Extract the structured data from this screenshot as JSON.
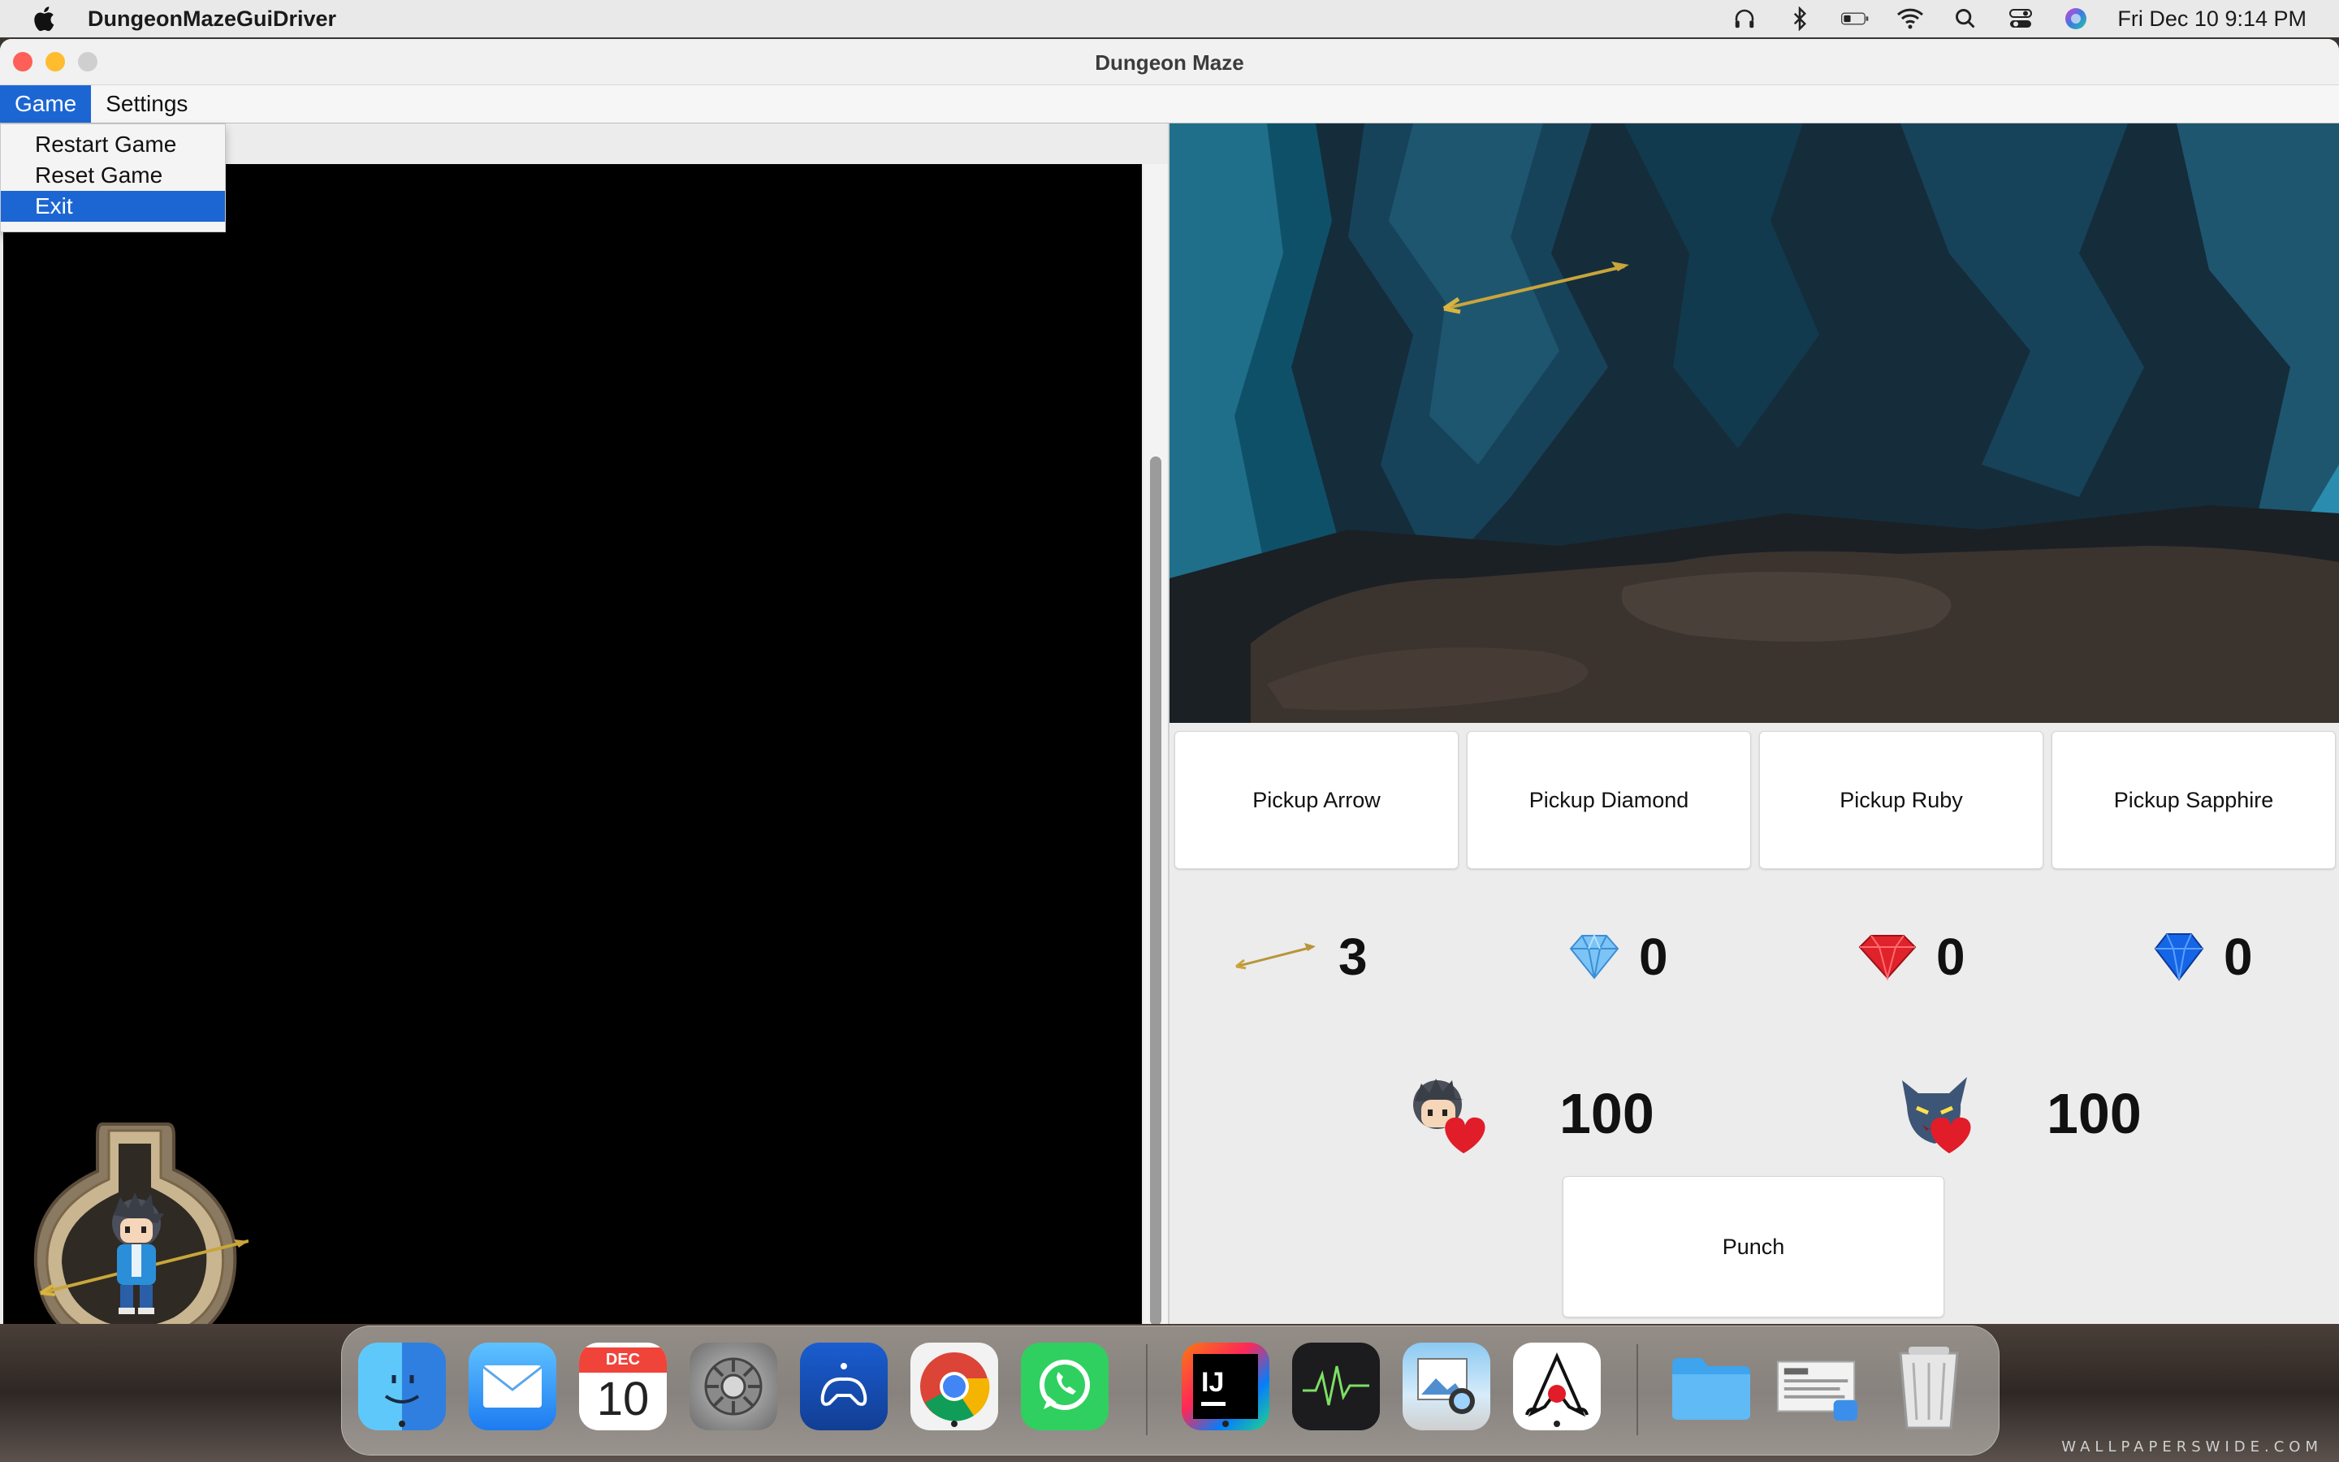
{
  "menubar": {
    "app_name": "DungeonMazeGuiDriver",
    "clock": "Fri Dec 10  9:14 PM"
  },
  "window": {
    "title": "Dungeon Maze",
    "menus": [
      "Game",
      "Settings"
    ],
    "game_menu_items": [
      "Restart Game",
      "Reset Game",
      "Exit"
    ]
  },
  "actions": {
    "pickup_arrow": "Pickup Arrow",
    "pickup_diamond": "Pickup Diamond",
    "pickup_ruby": "Pickup Ruby",
    "pickup_sapphire": "Pickup Sapphire",
    "punch": "Punch"
  },
  "inventory": {
    "arrows": "3",
    "diamonds": "0",
    "rubies": "0",
    "sapphires": "0"
  },
  "health": {
    "player": "100",
    "monster": "100"
  },
  "dock": {
    "calendar_month": "DEC",
    "calendar_day": "10",
    "intellij_label": "IJ"
  },
  "wallpaper_mark": "WALLPAPERSWIDE.COM",
  "colors": {
    "menu_highlight": "#1c66d3",
    "ruby": "#e0222a",
    "sapphire": "#1565e6",
    "diamond": "#7cc4f5"
  }
}
